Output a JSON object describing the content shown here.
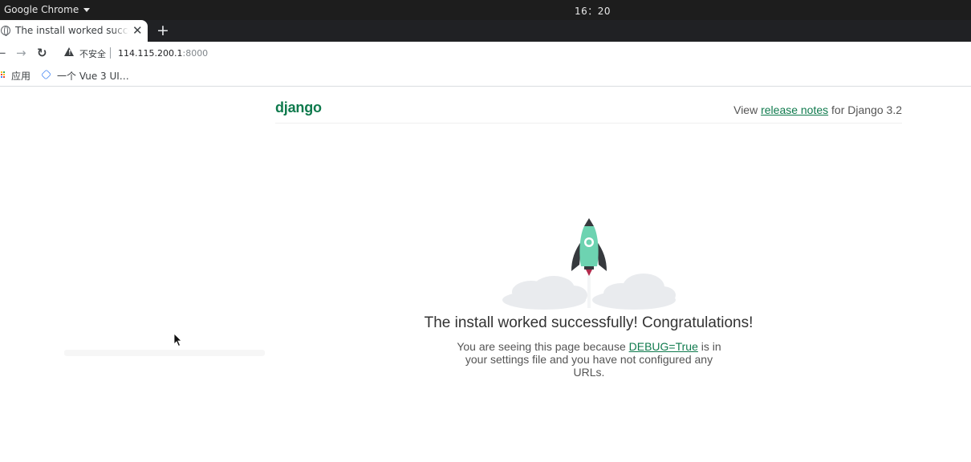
{
  "system_bar": {
    "app_name": "Google Chrome",
    "clock": "16：20"
  },
  "browser": {
    "tab": {
      "title": "The install worked successfully! Congratulations!",
      "icon": "globe-icon"
    },
    "address": {
      "security_label": "不安全",
      "host": "114.115.200.1",
      "port": ":8000"
    },
    "bookmarks": [
      {
        "label": "应用",
        "icon": "apps-grid-icon"
      },
      {
        "label": "一个 Vue 3 UI…",
        "icon": "vue-icon"
      }
    ]
  },
  "page": {
    "logo": "django",
    "release": {
      "prefix": "View ",
      "link": "release notes",
      "suffix": " for Django 3.2"
    },
    "headline": "The install worked successfully! Congratulations!",
    "body": {
      "prefix": "You are seeing this page because ",
      "link": "DEBUG=True",
      "suffix": " is in your settings file and you have not configured any URLs."
    }
  },
  "colors": {
    "django_green": "#0f7a4d",
    "rocket_body": "#6dd3b1",
    "rocket_dark": "#36393d",
    "flame": "#b22a4b",
    "cloud": "#e9ebee"
  }
}
